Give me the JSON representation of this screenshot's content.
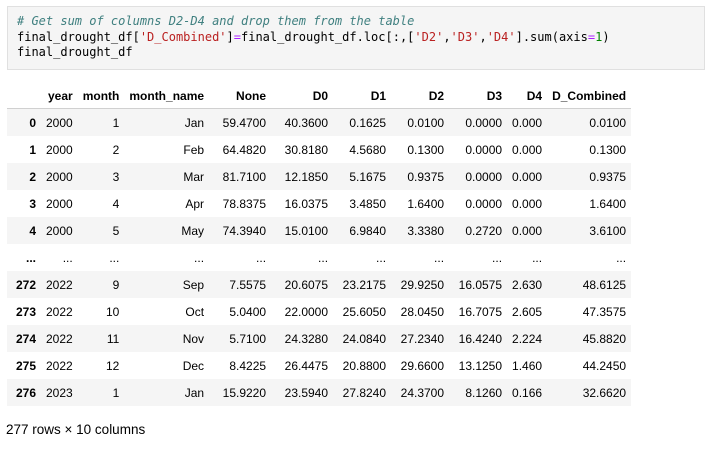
{
  "code": {
    "comment": "# Get sum of columns D2-D4 and drop them from the table",
    "line2": {
      "var": "final_drought_df",
      "key": "'D_Combined'",
      "rhs_var": "final_drought_df",
      "loc": ".loc[:,",
      "cols": [
        "'D2'",
        "'D3'",
        "'D4'"
      ],
      "sum": "].sum(axis",
      "eq": "=",
      "arg": "1",
      "close": ")"
    },
    "line3": "final_drought_df"
  },
  "table": {
    "index_header": "",
    "columns": [
      "year",
      "month",
      "month_name",
      "None",
      "D0",
      "D1",
      "D2",
      "D3",
      "D4",
      "D_Combined"
    ],
    "rows": [
      {
        "index": "0",
        "cells": [
          "2000",
          "1",
          "Jan",
          "59.4700",
          "40.3600",
          "0.1625",
          "0.0100",
          "0.0000",
          "0.000",
          "0.0100"
        ]
      },
      {
        "index": "1",
        "cells": [
          "2000",
          "2",
          "Feb",
          "64.4820",
          "30.8180",
          "4.5680",
          "0.1300",
          "0.0000",
          "0.000",
          "0.1300"
        ]
      },
      {
        "index": "2",
        "cells": [
          "2000",
          "3",
          "Mar",
          "81.7100",
          "12.1850",
          "5.1675",
          "0.9375",
          "0.0000",
          "0.000",
          "0.9375"
        ]
      },
      {
        "index": "3",
        "cells": [
          "2000",
          "4",
          "Apr",
          "78.8375",
          "16.0375",
          "3.4850",
          "1.6400",
          "0.0000",
          "0.000",
          "1.6400"
        ]
      },
      {
        "index": "4",
        "cells": [
          "2000",
          "5",
          "May",
          "74.3940",
          "15.0100",
          "6.9840",
          "3.3380",
          "0.2720",
          "0.000",
          "3.6100"
        ]
      },
      {
        "index": "...",
        "cells": [
          "...",
          "...",
          "...",
          "...",
          "...",
          "...",
          "...",
          "...",
          "...",
          "..."
        ]
      },
      {
        "index": "272",
        "cells": [
          "2022",
          "9",
          "Sep",
          "7.5575",
          "20.6075",
          "23.2175",
          "29.9250",
          "16.0575",
          "2.630",
          "48.6125"
        ]
      },
      {
        "index": "273",
        "cells": [
          "2022",
          "10",
          "Oct",
          "5.0400",
          "22.0000",
          "25.6050",
          "28.0450",
          "16.7075",
          "2.605",
          "47.3575"
        ]
      },
      {
        "index": "274",
        "cells": [
          "2022",
          "11",
          "Nov",
          "5.7100",
          "24.3280",
          "24.0840",
          "27.2340",
          "16.4240",
          "2.224",
          "45.8820"
        ]
      },
      {
        "index": "275",
        "cells": [
          "2022",
          "12",
          "Dec",
          "8.4225",
          "26.4475",
          "20.8800",
          "29.6600",
          "13.1250",
          "1.460",
          "44.2450"
        ]
      },
      {
        "index": "276",
        "cells": [
          "2023",
          "1",
          "Jan",
          "15.9220",
          "23.5940",
          "27.8240",
          "24.3700",
          "8.1260",
          "0.166",
          "32.6620"
        ]
      }
    ]
  },
  "shape_text": "277 rows × 10 columns"
}
